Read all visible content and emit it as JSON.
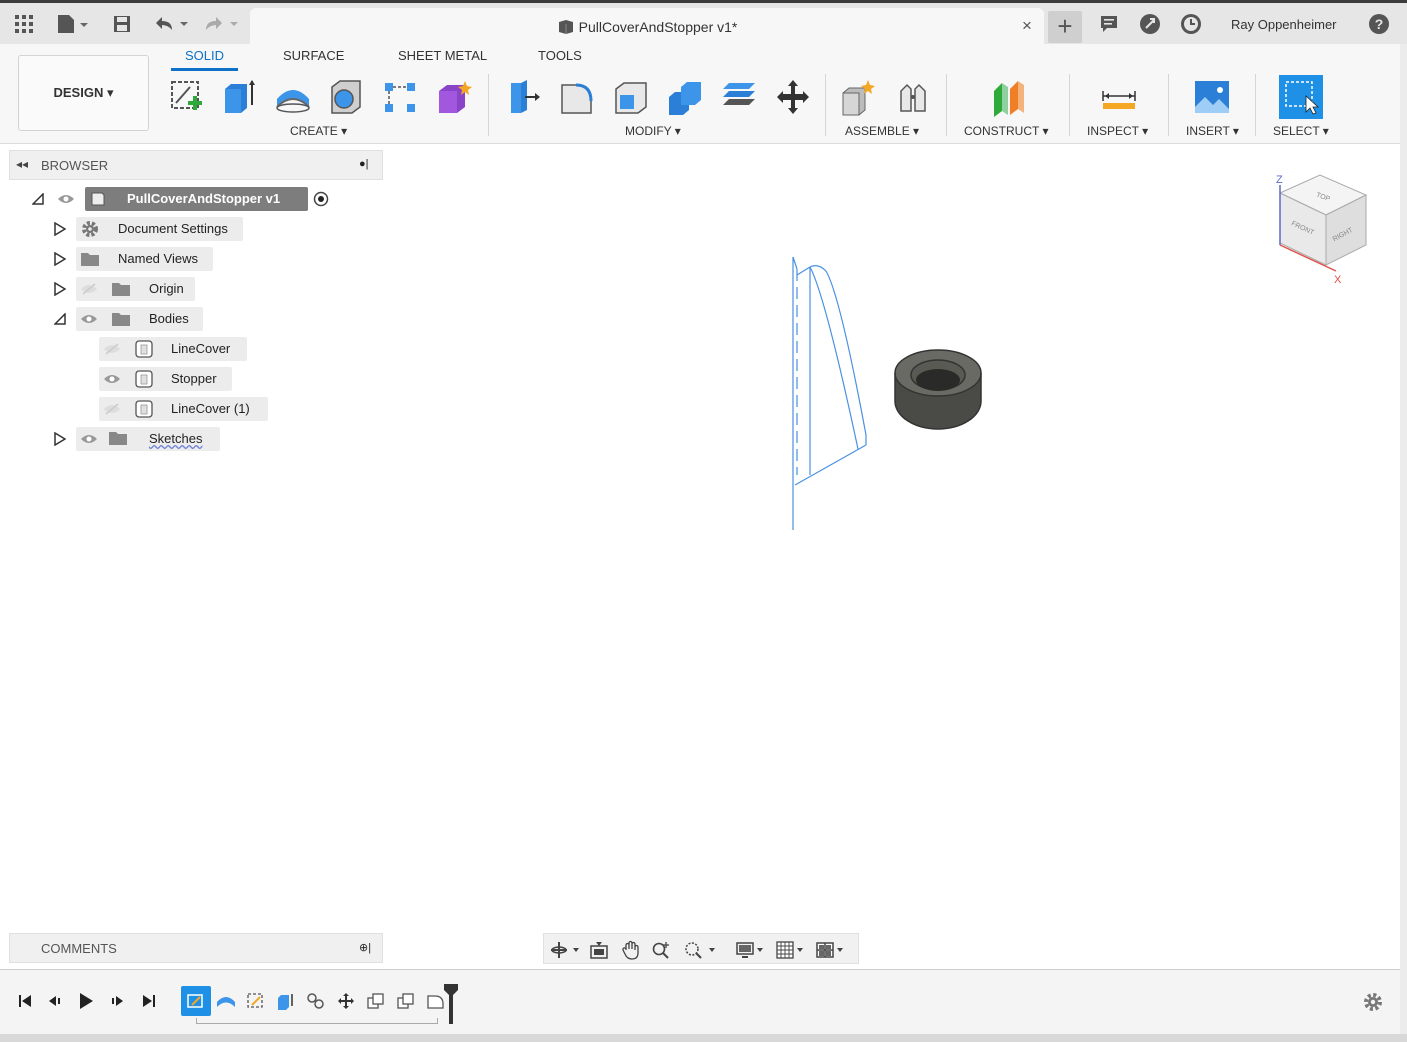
{
  "titlebar": {
    "document_title": "PullCoverAndStopper v1*",
    "close_glyph": "×",
    "new_tab_glyph": "+",
    "user_name": "Ray Oppenheimer",
    "help_glyph": "?",
    "icons": [
      "apps-grid-icon",
      "file-icon",
      "save-icon",
      "undo-icon",
      "redo-icon",
      "notifications-icon",
      "job-status-icon",
      "clock-icon",
      "help-icon"
    ]
  },
  "ribbon": {
    "tabs": [
      {
        "label": "SOLID",
        "active": true
      },
      {
        "label": "SURFACE",
        "active": false
      },
      {
        "label": "SHEET METAL",
        "active": false
      },
      {
        "label": "TOOLS",
        "active": false
      }
    ],
    "workspace_button": "DESIGN ▾",
    "groups": {
      "create": "CREATE ▾",
      "modify": "MODIFY ▾",
      "assemble": "ASSEMBLE ▾",
      "construct": "CONSTRUCT ▾",
      "inspect": "INSPECT ▾",
      "insert": "INSERT ▾",
      "select": "SELECT ▾"
    },
    "accent": "#0f70c8"
  },
  "browser": {
    "title": "BROWSER",
    "root": "PullCoverAndStopper v1",
    "items": [
      {
        "label": "Document Settings"
      },
      {
        "label": "Named Views"
      },
      {
        "label": "Origin"
      },
      {
        "label": "Bodies"
      },
      {
        "label": "LineCover"
      },
      {
        "label": "Stopper"
      },
      {
        "label": "LineCover (1)"
      },
      {
        "label": "Sketches"
      }
    ]
  },
  "viewcube": {
    "faces": [
      "TOP",
      "FRONT",
      "RIGHT"
    ],
    "axes": [
      "Z",
      "X"
    ]
  },
  "comments": {
    "title": "COMMENTS"
  },
  "colors": {
    "sketch_line": "#4a90e2",
    "body_dark": "#4a4a46",
    "selection_blue": "#1e90e6"
  }
}
